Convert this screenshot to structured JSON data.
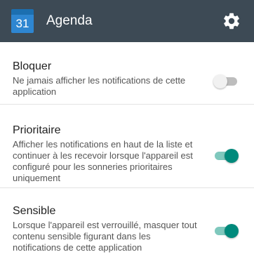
{
  "app_bar": {
    "calendar_day": "31",
    "title": "Agenda",
    "settings_icon": "gear-icon",
    "background": "#3d4a55"
  },
  "settings": [
    {
      "title": "Bloquer",
      "description": "Ne jamais afficher les notifications de cette application",
      "enabled": false
    },
    {
      "title": "Prioritaire",
      "description": "Afficher les notifications en haut de la liste et continuer à les recevoir lorsque l'appareil est configuré pour les sonneries prioritaires uniquement",
      "enabled": true
    },
    {
      "title": "Sensible",
      "description": "Lorsque l'appareil est verrouillé, masquer tout contenu sensible figurant dans les notifications de cette application",
      "enabled": true
    }
  ],
  "colors": {
    "toggle_on": "#00897b",
    "toggle_off": "#bdbdbd"
  }
}
